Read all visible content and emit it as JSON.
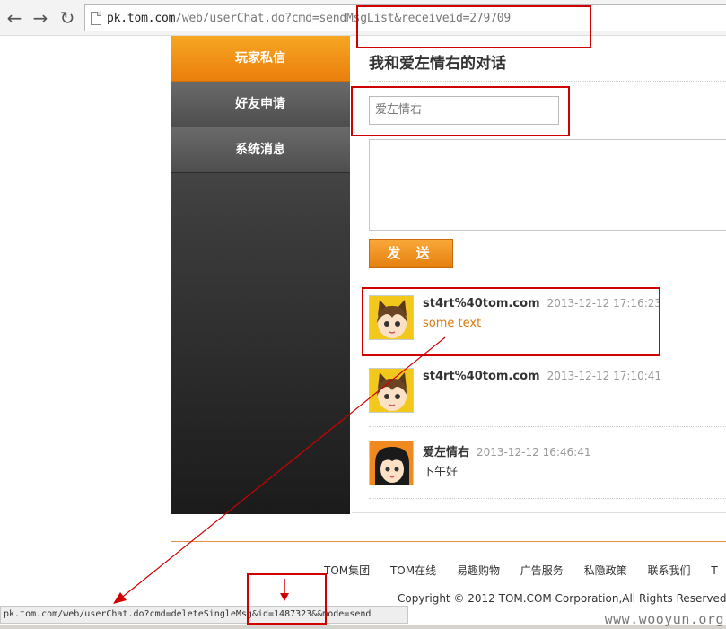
{
  "browser": {
    "back_icon": "arrow-left-icon",
    "forward_icon": "arrow-right-icon",
    "reload_icon": "reload-icon",
    "url_host": "pk.tom.com",
    "url_path": "/web/userChat.do?cmd=sendMsgList&receiveid=279709",
    "status_url": "pk.tom.com/web/userChat.do?cmd=deleteSingleMsg&id=1487323&&mode=send"
  },
  "sidebar": {
    "items": [
      {
        "label": "玩家私信",
        "active": true
      },
      {
        "label": "好友申请",
        "active": false
      },
      {
        "label": "系统消息",
        "active": false
      }
    ]
  },
  "main": {
    "title": "我和爱左情右的对话",
    "recipient_value": "爱左情右",
    "send_label": "发 送"
  },
  "messages": [
    {
      "sender": "st4rt%40tom.com",
      "time": "2013-12-12 17:16:23",
      "text": "some text",
      "avatar": "cat-ear-girl-avatar"
    },
    {
      "sender": "st4rt%40tom.com",
      "time": "2013-12-12 17:10:41",
      "text": "",
      "avatar": "cat-ear-girl-avatar"
    },
    {
      "sender": "爱左情右",
      "time": "2013-12-12 16:46:41",
      "text": "下午好",
      "avatar": "black-hair-girl-avatar"
    }
  ],
  "footer": {
    "links": [
      "TOM集团",
      "TOM在线",
      "易趣购物",
      "广告服务",
      "私隐政策",
      "联系我们",
      "T"
    ],
    "copyright": "Copyright © 2012 TOM.COM Corporation,All Rights Reserved"
  },
  "watermark": "www.wooyun.org",
  "colors": {
    "accent_orange": "#ea7f0c",
    "annotation_red": "#d00000",
    "sidebar_dark": "#1b1b1b"
  }
}
